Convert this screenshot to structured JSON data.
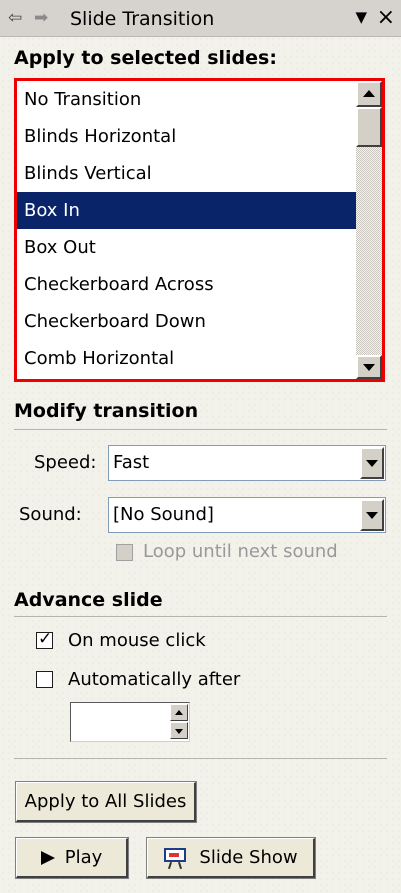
{
  "pane": {
    "title": "Slide Transition",
    "back_icon": "arrow-left-icon",
    "forward_icon": "arrow-right-icon",
    "menu_icon": "chevron-down-icon",
    "close_glyph": "×"
  },
  "apply_section": {
    "heading": "Apply to selected slides:",
    "selected": "Box In",
    "items": [
      "No Transition",
      "Blinds Horizontal",
      "Blinds Vertical",
      "Box In",
      "Box Out",
      "Checkerboard Across",
      "Checkerboard Down",
      "Comb Horizontal"
    ],
    "highlight_color": "#ee0000",
    "selection_color": "#0a246a"
  },
  "modify_section": {
    "heading": "Modify transition",
    "speed_label": "Speed:",
    "speed_value": "Fast",
    "sound_label": "Sound:",
    "sound_value": "[No Sound]",
    "loop_label": "Loop until next sound",
    "loop_checked": false,
    "loop_enabled": false
  },
  "advance_section": {
    "heading": "Advance slide",
    "mouse_click_label": "On mouse click",
    "mouse_click_checked": true,
    "auto_label": "Automatically after",
    "auto_checked": false,
    "auto_value": ""
  },
  "buttons": {
    "apply_all": "Apply to All Slides",
    "play": "Play",
    "slide_show": "Slide Show"
  }
}
